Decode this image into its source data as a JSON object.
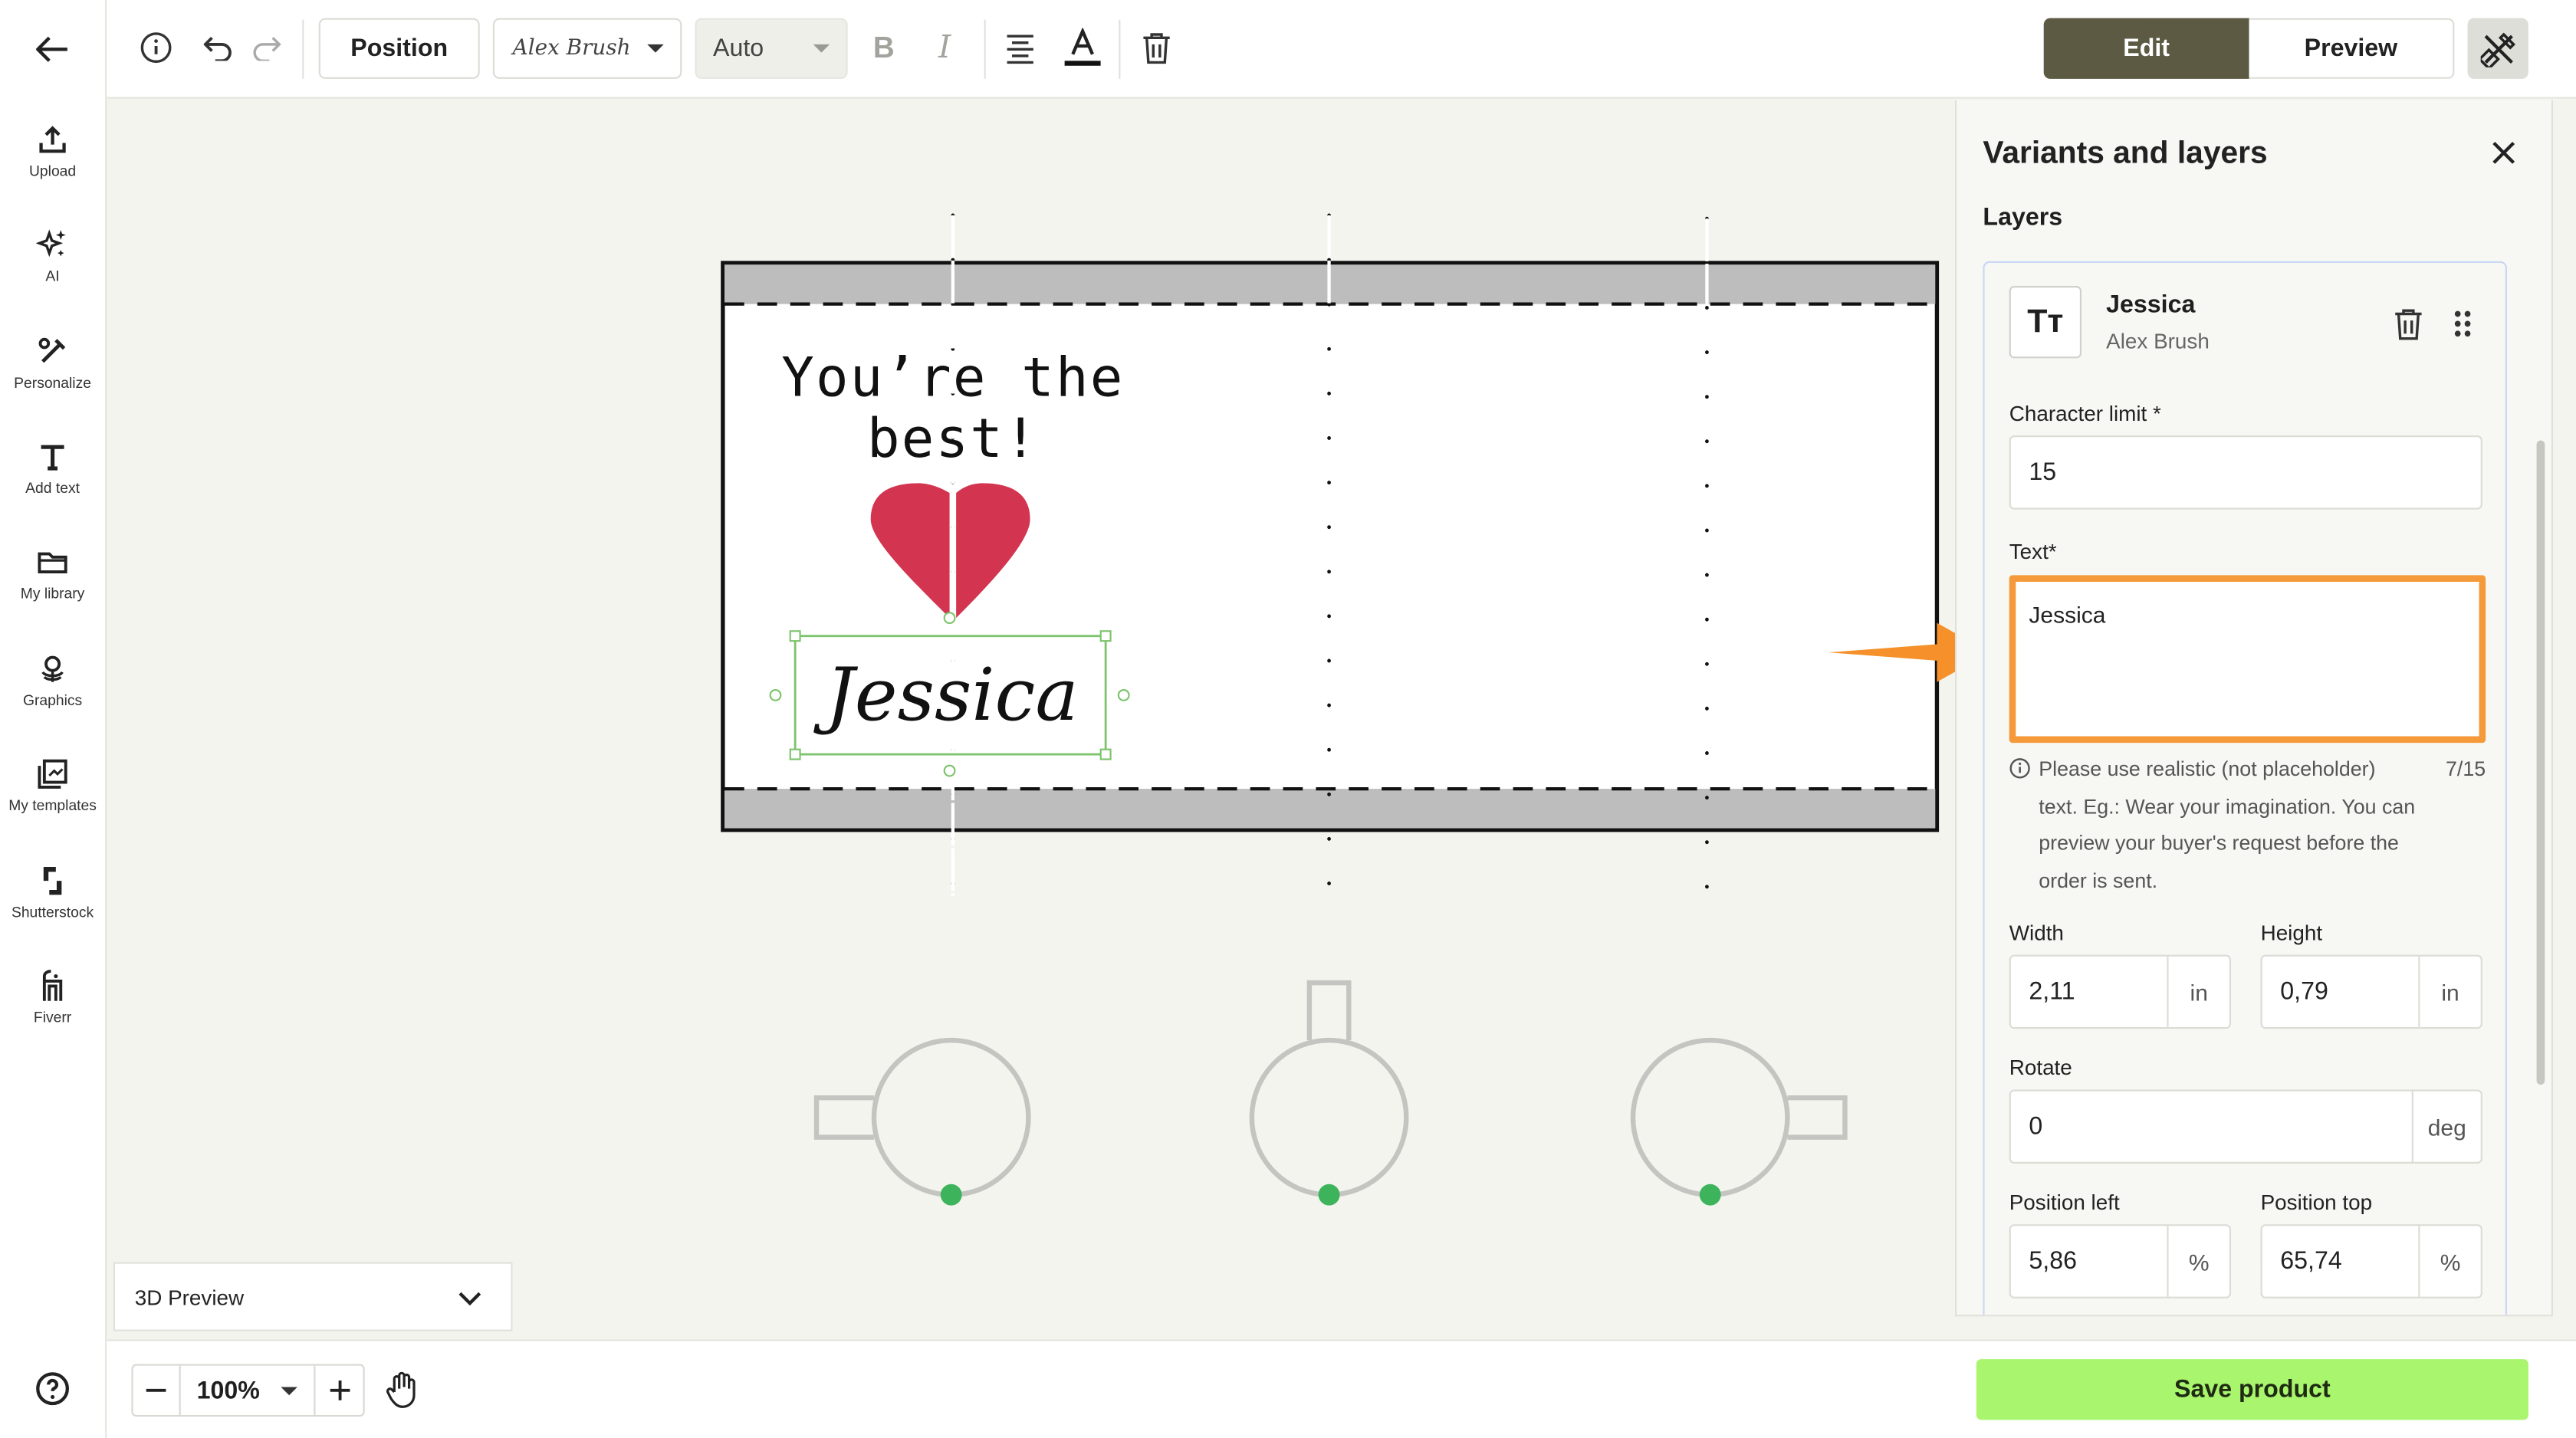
{
  "rail": {
    "items": [
      {
        "label": "Upload",
        "icon": "upload-icon"
      },
      {
        "label": "AI",
        "icon": "ai-sparkle-icon"
      },
      {
        "label": "Personalize",
        "icon": "personalize-icon"
      },
      {
        "label": "Add text",
        "icon": "text-icon"
      },
      {
        "label": "My library",
        "icon": "folder-icon"
      },
      {
        "label": "Graphics",
        "icon": "graphics-icon"
      },
      {
        "label": "My templates",
        "icon": "templates-icon"
      },
      {
        "label": "Shutterstock",
        "icon": "shutterstock-icon"
      },
      {
        "label": "Fiverr",
        "icon": "fiverr-icon"
      }
    ]
  },
  "toolbar": {
    "position_label": "Position",
    "font_label": "Alex Brush",
    "size_label": "Auto",
    "bold_label": "B",
    "italic_label": "I",
    "edit_label": "Edit",
    "preview_label": "Preview"
  },
  "canvas": {
    "headline_line1": "You’re the",
    "headline_line2": "best!",
    "name_text": "Jessica",
    "accent_color": "#d3344f",
    "selection_color": "#7cc36b",
    "handle_dot_color": "#3db35b"
  },
  "preview_select": {
    "value": "3D Preview"
  },
  "bottom": {
    "zoom_value": "100%",
    "save_label": "Save product",
    "save_color": "#a9f56e"
  },
  "panel": {
    "title": "Variants and layers",
    "layers_heading": "Layers",
    "layer": {
      "icon_label": "Tт",
      "name": "Jessica",
      "font": "Alex Brush",
      "char_limit_label": "Character limit",
      "char_limit_value": "15",
      "text_label": "Text",
      "text_value": "Jessica",
      "hint": "Please use realistic (not placeholder) text. Eg.: Wear your imagination. You can preview your buyer's request before the order is sent.",
      "hint_count": "7/15",
      "width_label": "Width",
      "width_value": "2,11",
      "height_label": "Height",
      "height_value": "0,79",
      "unit_in": "in",
      "rotate_label": "Rotate",
      "rotate_value": "0",
      "unit_deg": "deg",
      "pos_left_label": "Position left",
      "pos_left_value": "5,86",
      "pos_top_label": "Position top",
      "pos_top_value": "65,74",
      "unit_pct": "%",
      "required_mark": "*"
    }
  },
  "annotation_arrow_color": "#f5902a"
}
